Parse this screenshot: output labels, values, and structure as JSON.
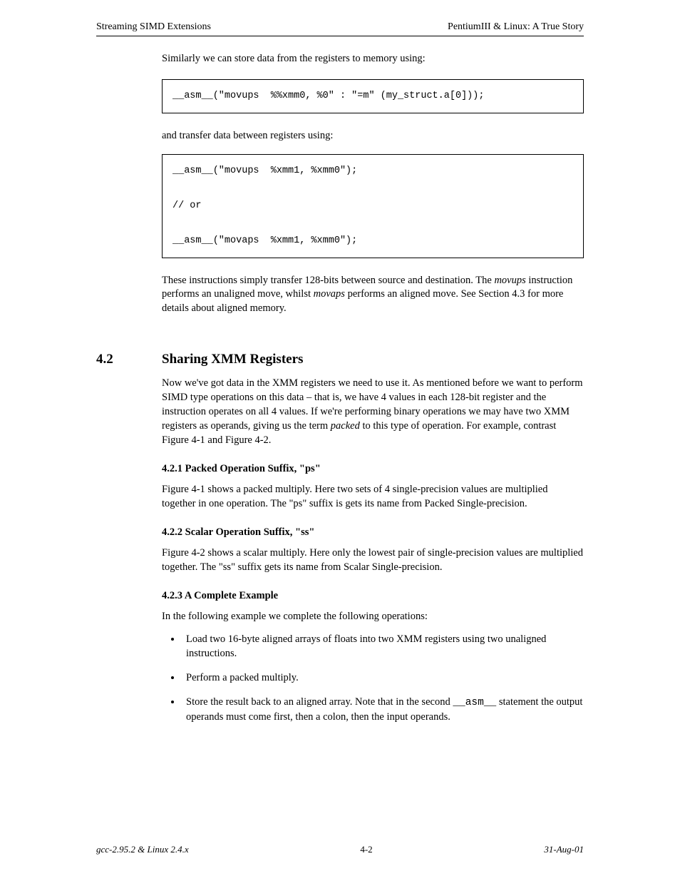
{
  "header": {
    "left": "Streaming SIMD Extensions",
    "right": "PentiumIII & Linux: A True Story"
  },
  "lead": "Similarly we can store data from the registers to memory using:",
  "codebox1": "__asm__(\"movups  %%xmm0, %0\" : \"=m\" (my_struct.a[0]));",
  "inter": "and transfer data between registers using:",
  "codebox2": "__asm__(\"movups  %xmm1, %xmm0\");\n\n// or\n\n__asm__(\"movaps  %xmm1, %xmm0\");",
  "outro_parts": {
    "pre_italic": "These instructions simply transfer 128-bits between source and destination. The ",
    "italic1": "movups",
    "mid1": " instruction performs an unaligned move, whilst ",
    "italic2": "movaps",
    "mid2": " performs an aligned move. See Section 4.3 for more details about aligned memory."
  },
  "section": {
    "number": "4.2",
    "title": "Sharing XMM Registers"
  },
  "para1_parts": {
    "p": "Now we've got data in the XMM registers we need to use it. As mentioned before we want to perform SIMD type operations on this data – that is, we have 4 values in each 128-bit register and the instruction operates on all 4 values. If we're performing binary operations we may have two XMM registers as operands, giving us the term ",
    "italic": "packed",
    "suffix": " to this type of operation. For example, contrast Figure 4-1 and Figure 4-2."
  },
  "sub1": "4.2.1 Packed Operation Suffix, \"ps\"",
  "para2": "Figure 4-1 shows a packed multiply. Here two sets of 4 single-precision values are multiplied together in one operation. The \"ps\" suffix is gets its name from Packed Single-precision.",
  "sub2": "4.2.2 Scalar Operation Suffix, \"ss\"",
  "para3": "Figure 4-2 shows a scalar multiply. Here only the lowest pair of single-precision values are multiplied together. The \"ss\" suffix gets its name from Scalar Single-precision.",
  "sub3": "4.2.3 A Complete Example",
  "para4": "In the following example we complete the following operations:",
  "bullets": [
    "Load two 16-byte aligned arrays of floats into two XMM registers using two unaligned instructions.",
    "Perform a packed multiply.",
    "Store the result back to an aligned array. Note that in the second __asm__ statement the output operands must come first, then a colon, then the input operands."
  ],
  "footer": {
    "left": "gcc-2.95.2 & Linux 2.4.x",
    "center": "4-2",
    "right": "31-Aug-01"
  }
}
